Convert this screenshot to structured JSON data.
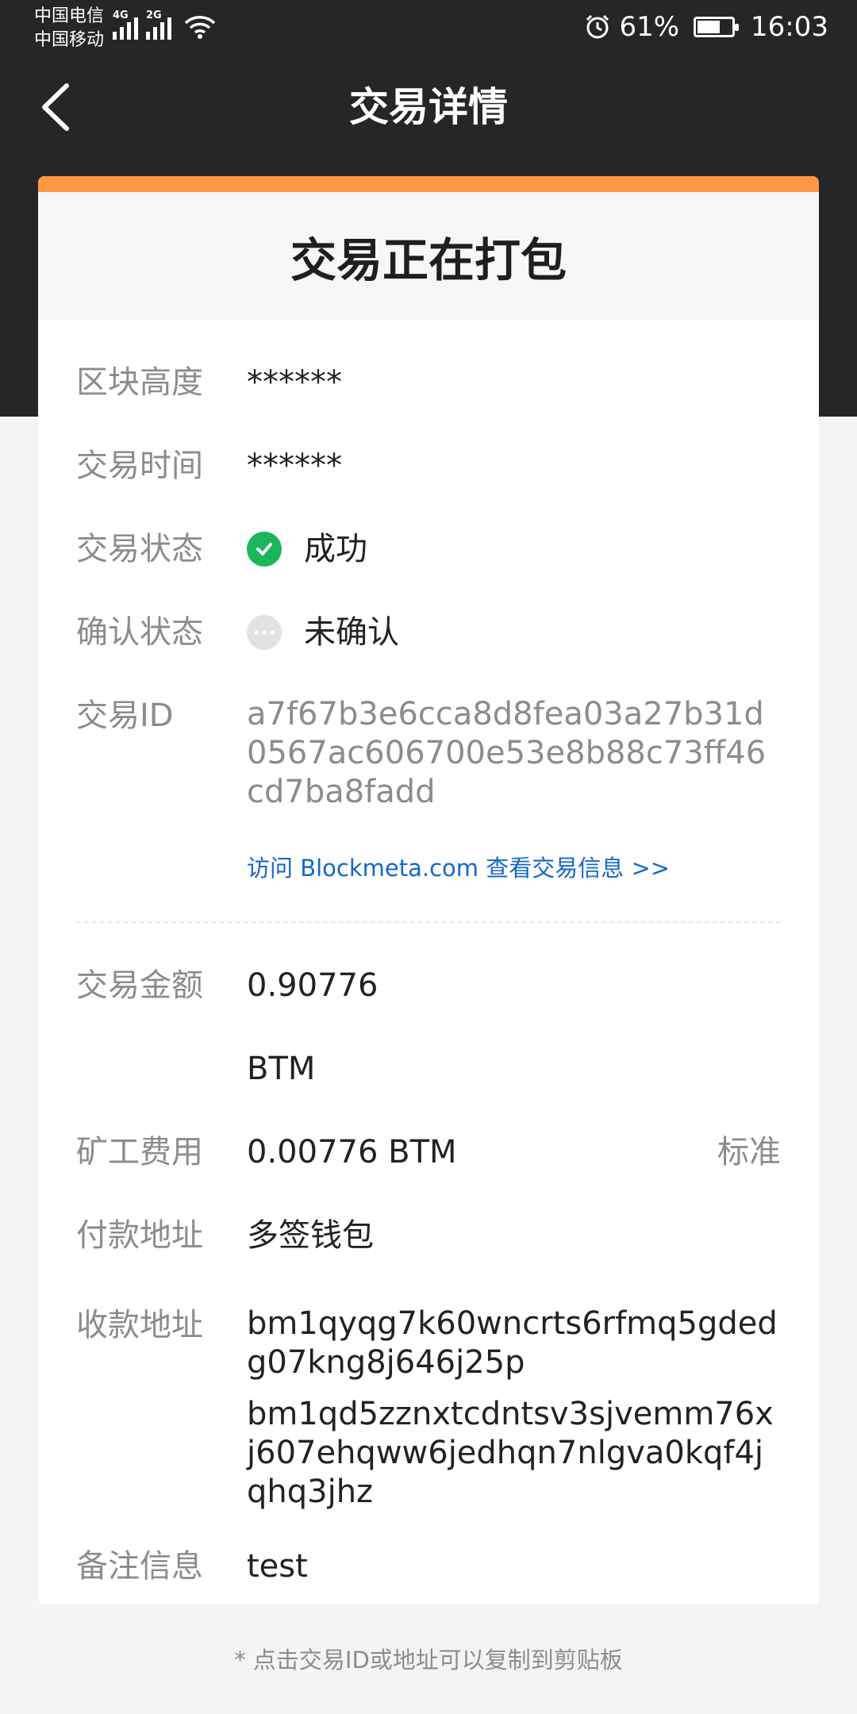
{
  "status_bar": {
    "carrier1": "中国电信",
    "carrier2": "中国移动",
    "net1": "4G",
    "net2": "2G",
    "battery": "61%",
    "time": "16:03"
  },
  "nav": {
    "title": "交易详情"
  },
  "card": {
    "header": "交易正在打包",
    "block_height": {
      "label": "区块高度",
      "value": "******"
    },
    "tx_time": {
      "label": "交易时间",
      "value": "******"
    },
    "tx_status": {
      "label": "交易状态",
      "value": "成功"
    },
    "confirm_status": {
      "label": "确认状态",
      "value": "未确认"
    },
    "tx_id": {
      "label": "交易ID",
      "value": "a7f67b3e6cca8d8fea03a27b31d0567ac606700e53e8b88c73ff46cd7ba8fadd"
    },
    "explorer_link": "访问 Blockmeta.com 查看交易信息 >>",
    "amount": {
      "label": "交易金额",
      "value": "0.90776",
      "unit": "BTM"
    },
    "fee": {
      "label": "矿工费用",
      "value": "0.00776 BTM",
      "tag": "标准"
    },
    "from": {
      "label": "付款地址",
      "value": "多签钱包"
    },
    "to": {
      "label": "收款地址",
      "values": [
        "bm1qyqg7k60wncrts6rfmq5gdedg07kng8j646j25p",
        "bm1qd5zznxtcdntsv3sjvemm76xj607ehqww6jedhqn7nlgva0kqf4jqhq3jhz"
      ]
    },
    "memo": {
      "label": "备注信息",
      "value": "test"
    }
  },
  "footnote": "* 点击交易ID或地址可以复制到剪贴板",
  "colors": {
    "accent": "#ff9845",
    "success": "#1bb55c",
    "link": "#1567c9",
    "header_bg": "#262626"
  }
}
